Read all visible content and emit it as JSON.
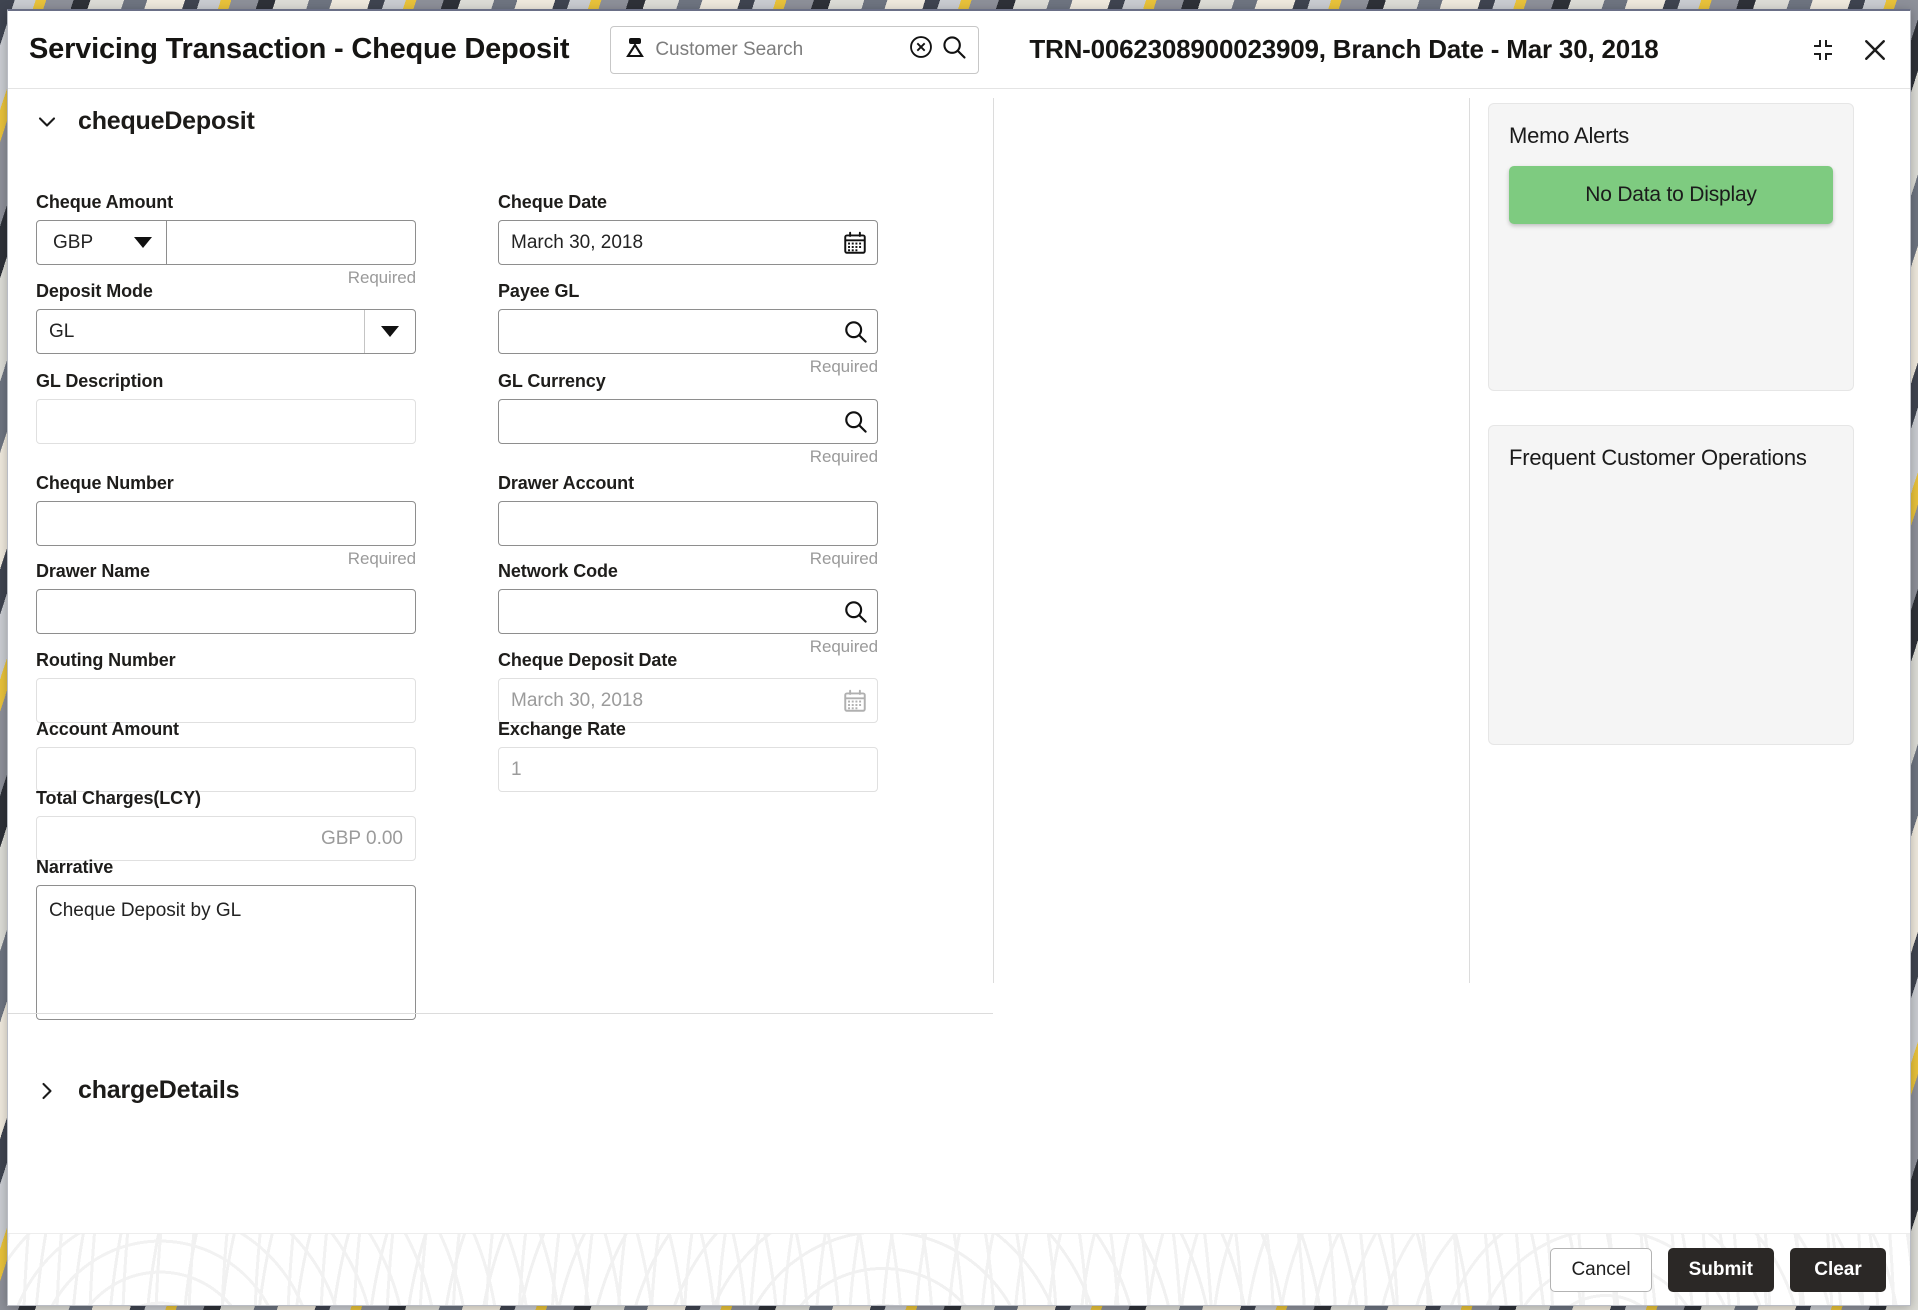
{
  "header": {
    "title": "Servicing Transaction - Cheque Deposit",
    "transaction_ref": "TRN-0062308900023909, Branch Date - Mar 30, 2018",
    "customer_search": {
      "placeholder": "Customer Search",
      "value": "",
      "person_icon": "person-icon",
      "clear_icon": "clear-circle-icon",
      "search_icon": "search-icon"
    },
    "expand_icon": "collapse-expand-icon",
    "close_icon": "close-icon"
  },
  "sections": {
    "cheque_deposit": {
      "label": "chequeDeposit",
      "expanded": true,
      "icon": "chevron-down-icon"
    },
    "charge_details": {
      "label": "chargeDetails",
      "expanded": false,
      "icon": "chevron-right-icon"
    }
  },
  "fields": {
    "cheque_amount": {
      "label": "Cheque Amount",
      "currency": "GBP",
      "amount_value": "",
      "required_note": "Required",
      "caret_icon": "caret-down-icon"
    },
    "cheque_date": {
      "label": "Cheque Date",
      "value": "March 30, 2018",
      "icon": "calendar-icon"
    },
    "deposit_mode": {
      "label": "Deposit Mode",
      "value": "GL",
      "caret_icon": "caret-down-icon"
    },
    "payee_gl": {
      "label": "Payee GL",
      "value": "",
      "required_note": "Required",
      "icon": "search-icon"
    },
    "gl_description": {
      "label": "GL Description",
      "value": ""
    },
    "gl_currency": {
      "label": "GL Currency",
      "value": "",
      "required_note": "Required",
      "icon": "search-icon"
    },
    "cheque_number": {
      "label": "Cheque Number",
      "value": "",
      "required_note": "Required"
    },
    "drawer_account": {
      "label": "Drawer Account",
      "value": "",
      "required_note": "Required"
    },
    "drawer_name": {
      "label": "Drawer Name",
      "value": ""
    },
    "network_code": {
      "label": "Network Code",
      "value": "",
      "required_note": "Required",
      "icon": "search-icon"
    },
    "routing_number": {
      "label": "Routing Number",
      "value": ""
    },
    "cheque_deposit_date": {
      "label": "Cheque Deposit Date",
      "value": "March 30, 2018",
      "icon": "calendar-icon"
    },
    "account_amount": {
      "label": "Account Amount",
      "value": ""
    },
    "exchange_rate": {
      "label": "Exchange Rate",
      "value": "1"
    },
    "total_charges_lcy": {
      "label": "Total Charges(LCY)",
      "value": "GBP 0.00"
    },
    "narrative": {
      "label": "Narrative",
      "value": "Cheque Deposit by GL"
    }
  },
  "side_panels": {
    "memo_alerts": {
      "title": "Memo Alerts",
      "empty_message": "No Data to Display",
      "empty_color": "#7ecb80"
    },
    "frequent_customer_operations": {
      "title": "Frequent Customer Operations"
    }
  },
  "footer": {
    "cancel_label": "Cancel",
    "submit_label": "Submit",
    "clear_label": "Clear"
  }
}
